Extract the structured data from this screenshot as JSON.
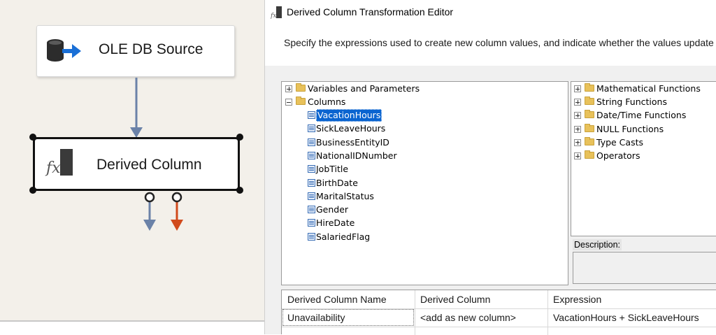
{
  "designer": {
    "source_node": {
      "label": "OLE DB Source",
      "icon": "database-output-icon"
    },
    "derived_node": {
      "label": "Derived Column",
      "icon": "fx-icon"
    },
    "colors": {
      "path_blue": "#6b82a8",
      "path_red": "#d14a1c"
    }
  },
  "editor": {
    "title": "Derived Column Transformation Editor",
    "instructions": "Specify the expressions used to create new column values, and indicate whether the values update",
    "columns_tree": {
      "variables_label": "Variables and Parameters",
      "columns_label": "Columns",
      "columns": [
        "VacationHours",
        "SickLeaveHours",
        "BusinessEntityID",
        "NationalIDNumber",
        "JobTitle",
        "BirthDate",
        "MaritalStatus",
        "Gender",
        "HireDate",
        "SalariedFlag"
      ],
      "selected": "VacationHours"
    },
    "functions_tree": [
      "Mathematical Functions",
      "String Functions",
      "Date/Time Functions",
      "NULL Functions",
      "Type Casts",
      "Operators"
    ],
    "description_label": "Description:",
    "grid": {
      "headers": [
        "Derived Column Name",
        "Derived Column",
        "Expression"
      ],
      "rows": [
        [
          "Unavailability",
          "<add as new column>",
          "VacationHours + SickLeaveHours"
        ]
      ]
    },
    "colors": {
      "selection": "#0a64d0",
      "folder": "#e8c15a"
    }
  }
}
